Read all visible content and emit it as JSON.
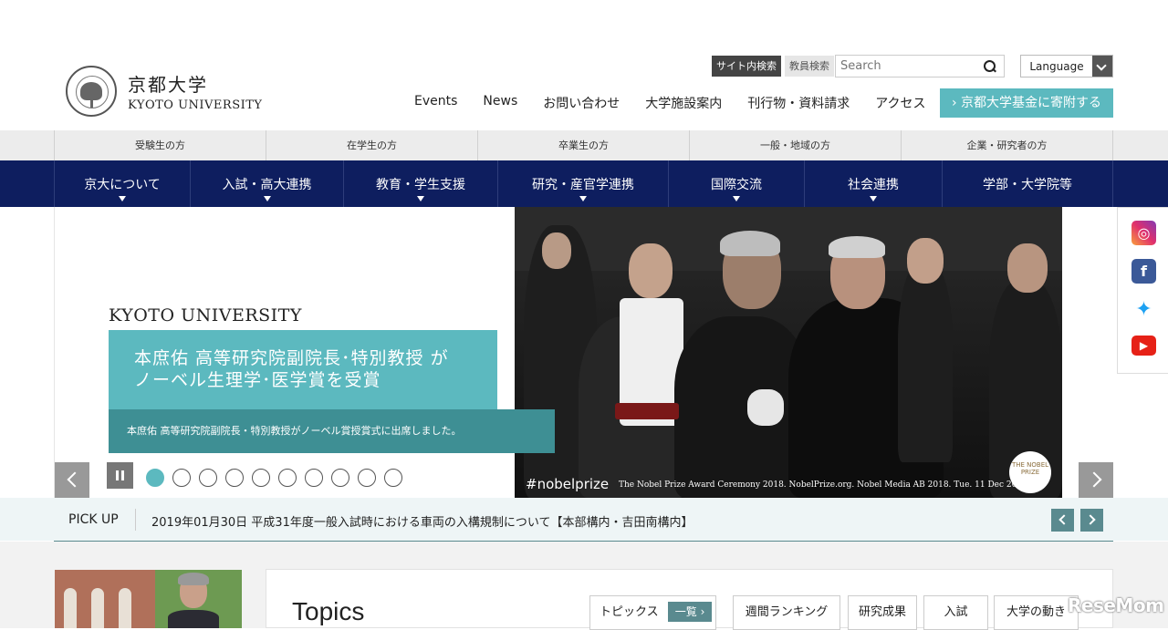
{
  "logo": {
    "ja": "京都大学",
    "en": "KYOTO UNIVERSITY"
  },
  "search": {
    "scope_site": "サイト内検索",
    "scope_staff": "教員検索",
    "placeholder": "Search"
  },
  "language": {
    "label": "Language"
  },
  "top_nav": [
    "Events",
    "News",
    "お問い合わせ",
    "大学施設案内",
    "刊行物・資料請求",
    "アクセス"
  ],
  "fund_button": "京都大学基金に寄附する",
  "audience_nav": [
    "受験生の方",
    "在学生の方",
    "卒業生の方",
    "一般・地域の方",
    "企業・研究者の方"
  ],
  "main_nav": [
    "京大について",
    "入試・高大連携",
    "教育・学生支援",
    "研究・産官学連携",
    "国際交流",
    "社会連携",
    "学部・大学院等"
  ],
  "hero": {
    "brand": "KYOTO UNIVERSITY",
    "title_line1": "本庶佑 高等研究院副院長･特別教授 が",
    "title_line2": "ノーベル生理学･医学賞を受賞",
    "subtitle": "本庶佑 高等研究院副院長・特別教授がノーベル賞授賞式に出席しました。",
    "photo_tag": "#nobelprize",
    "photo_caption": "The Nobel Prize Award Ceremony 2018. NobelPrize.org. Nobel Media AB 2018. Tue. 11 Dec 2018.",
    "seal_text": "THE NOBEL PRIZE",
    "slide_count": 10,
    "active_slide": 1
  },
  "social": [
    "instagram-icon",
    "facebook-icon",
    "twitter-icon",
    "youtube-icon"
  ],
  "pickup": {
    "label": "PICK UP",
    "text": "2019年01月30日 平成31年度一般入試時における車両の入構規制について【本部構内・吉田南構内】"
  },
  "topics": {
    "title": "Topics",
    "tabs": [
      {
        "label": "トピックス",
        "extra": "一覧"
      },
      {
        "label": "週間ランキング"
      },
      {
        "label": "研究成果"
      },
      {
        "label": "入試"
      },
      {
        "label": "大学の動き"
      }
    ]
  },
  "watermark": "ReseMom",
  "colors": {
    "navy": "#0e1e5f",
    "teal": "#5cb9bf",
    "dark_teal": "#3e8f94"
  }
}
